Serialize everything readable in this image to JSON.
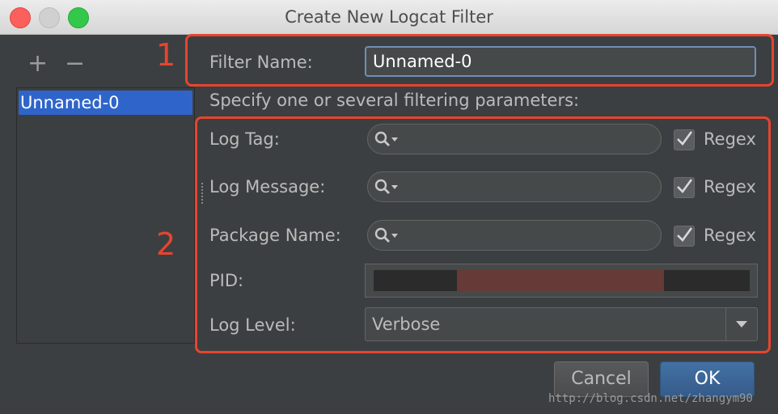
{
  "window": {
    "title": "Create New Logcat Filter"
  },
  "sidebar": {
    "add_label": "+",
    "remove_label": "−",
    "filters": [
      "Unnamed-0"
    ]
  },
  "form": {
    "filter_name_label": "Filter Name:",
    "filter_name_value": "Unnamed-0",
    "hint": "Specify one or several filtering parameters:",
    "log_tag_label": "Log Tag:",
    "log_message_label": "Log Message:",
    "package_name_label": "Package Name:",
    "regex_label": "Regex",
    "pid_label": "PID:",
    "log_level_label": "Log Level:",
    "log_level_value": "Verbose",
    "search_icon": "search-icon",
    "regex_checked": [
      true,
      true,
      true
    ]
  },
  "buttons": {
    "cancel": "Cancel",
    "ok": "OK"
  },
  "annotations": {
    "box1_number": "1",
    "box2_number": "2",
    "color": "#e8442e"
  },
  "watermark": "http://blog.csdn.net/zhangym90"
}
